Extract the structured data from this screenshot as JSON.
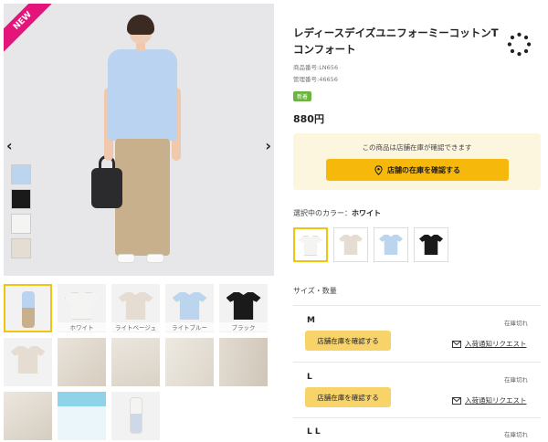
{
  "gallery": {
    "badge": "NEW",
    "prev_glyph": "‹",
    "next_glyph": "›",
    "thumbnails": [
      {
        "caption": "",
        "kind": "model"
      },
      {
        "caption": "ホワイト",
        "kind": "tee",
        "color": "#f4f4f2"
      },
      {
        "caption": "ライトベージュ",
        "kind": "tee",
        "color": "#e6ddd2"
      },
      {
        "caption": "ライトブルー",
        "kind": "tee",
        "color": "#bcd5ef"
      },
      {
        "caption": "ブラック",
        "kind": "tee",
        "color": "#1a1a1a"
      }
    ],
    "side_swatch_colors": [
      "#bcd5ef",
      "#1a1a1a",
      "#f4f4f2",
      "#e6ddd2"
    ]
  },
  "product": {
    "title": "レディースデイズユニフォーミーコットンTコンフォート",
    "product_code": "商品番号:LN656",
    "management_code": "管理番号:46656",
    "tag": "新着",
    "price": "880円"
  },
  "stock": {
    "note": "この商品は店舗在庫が確認できます",
    "button_label": "店舗の在庫を確認する"
  },
  "color": {
    "label_prefix": "選択中のカラー：",
    "selected_name": "ホワイト",
    "swatches": [
      {
        "name": "white",
        "color": "#f4f4f2"
      },
      {
        "name": "light-beige",
        "color": "#e6ddd2"
      },
      {
        "name": "light-blue",
        "color": "#bcd5ef"
      },
      {
        "name": "black",
        "color": "#1a1a1a"
      }
    ]
  },
  "sizes": {
    "label": "サイズ・数量",
    "items": [
      {
        "name": "M",
        "status": "在庫切れ",
        "button": "店舗在庫を確認する",
        "notify": "入荷通知リクエスト"
      },
      {
        "name": "L",
        "status": "在庫切れ",
        "button": "店舗在庫を確認する",
        "notify": "入荷通知リクエスト"
      },
      {
        "name": "L L",
        "status": "在庫切れ"
      }
    ]
  },
  "colors": {
    "accent": "#f5b80b",
    "new_badge": "#e4147a",
    "tag_green": "#6cb43f"
  }
}
